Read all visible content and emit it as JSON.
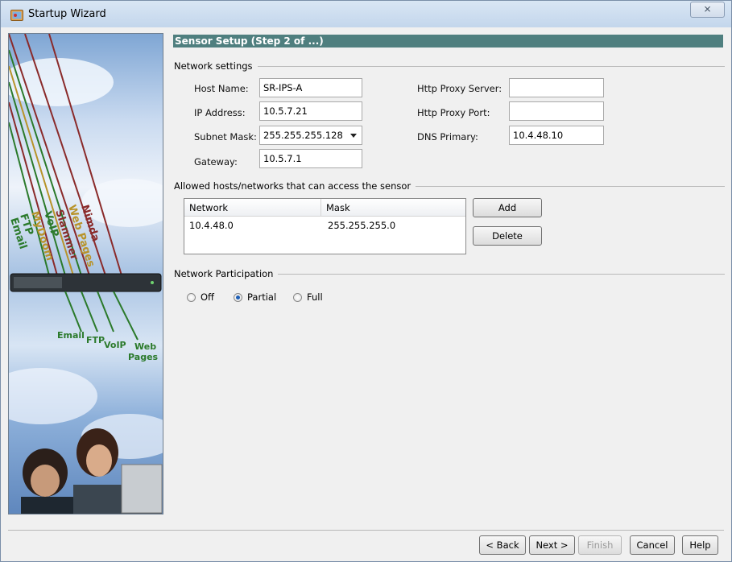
{
  "window": {
    "title": "Startup Wizard",
    "close_glyph": "⨯"
  },
  "sidebar": {
    "traffic_labels_top": [
      "Email",
      "FTP",
      "MyDoom",
      "VoIP",
      "Slammer",
      "Web Pages",
      "Nimda"
    ],
    "traffic_labels_bottom": [
      "Email",
      "FTP",
      "VoIP",
      "Web",
      "Pages"
    ]
  },
  "step_header": "Sensor Setup (Step 2 of ...)",
  "network_settings": {
    "title": "Network settings",
    "host_name_label": "Host Name:",
    "host_name_value": "SR-IPS-A",
    "ip_address_label": "IP Address:",
    "ip_address_value": "10.5.7.21",
    "subnet_mask_label": "Subnet Mask:",
    "subnet_mask_value": "255.255.255.128",
    "gateway_label": "Gateway:",
    "gateway_value": "10.5.7.1",
    "http_proxy_server_label": "Http Proxy Server:",
    "http_proxy_server_value": "",
    "http_proxy_port_label": "Http Proxy Port:",
    "http_proxy_port_value": "",
    "dns_primary_label": "DNS Primary:",
    "dns_primary_value": "10.4.48.10"
  },
  "allowed_hosts": {
    "title": "Allowed hosts/networks that can access the sensor",
    "columns": [
      "Network",
      "Mask"
    ],
    "rows": [
      {
        "network": "10.4.48.0",
        "mask": "255.255.255.0"
      }
    ],
    "add_label": "Add",
    "delete_label": "Delete"
  },
  "participation": {
    "title": "Network Participation",
    "options": [
      "Off",
      "Partial",
      "Full"
    ],
    "selected": "Partial"
  },
  "footer": {
    "back_label": "< Back",
    "next_label": "Next >",
    "finish_label": "Finish",
    "cancel_label": "Cancel",
    "help_label": "Help"
  },
  "colors": {
    "header_bg": "#4f7f7f",
    "radio_selected": "#1f5fb5"
  }
}
